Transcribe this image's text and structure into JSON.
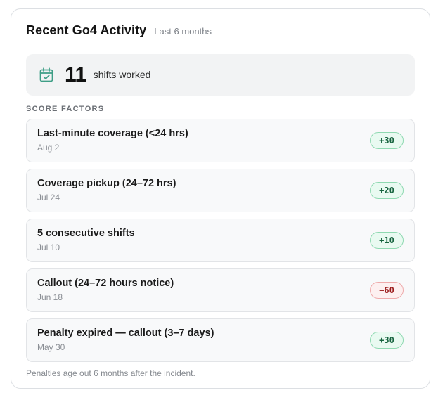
{
  "header": {
    "title": "Recent Go4 Activity",
    "subtitle": "Last 6 months"
  },
  "summary": {
    "icon": "calendar-check-icon",
    "count": "11",
    "label": "shifts worked",
    "icon_color": "#3e9e86"
  },
  "section_label": "SCORE FACTORS",
  "factors": [
    {
      "name": "Last-minute coverage (<24 hrs)",
      "date": "Aug 2",
      "points": "+30",
      "type": "pos"
    },
    {
      "name": "Coverage pickup (24–72 hrs)",
      "date": "Jul 24",
      "points": "+20",
      "type": "pos"
    },
    {
      "name": "5 consecutive shifts",
      "date": "Jul 10",
      "points": "+10",
      "type": "pos"
    },
    {
      "name": "Callout (24–72 hours notice)",
      "date": "Jun 18",
      "points": "−60",
      "type": "neg"
    },
    {
      "name": "Penalty expired — callout (3–7 days)",
      "date": "May 30",
      "points": "+30",
      "type": "pos"
    }
  ],
  "footnote": "Penalties age out 6 months after the incident.",
  "colors": {
    "positive_text": "#17643f",
    "positive_bg": "#e9faf1",
    "negative_text": "#9b1c1c",
    "negative_bg": "#fdf0f0"
  }
}
